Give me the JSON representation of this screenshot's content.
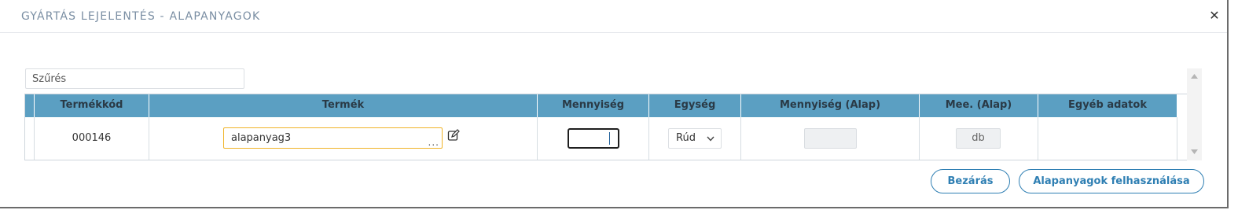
{
  "dialog": {
    "title": "GYÁRTÁS LEJELENTÉS - ALAPANYAGOK",
    "close_icon": "close-icon"
  },
  "filter": {
    "placeholder": "Szűrés"
  },
  "table": {
    "columns": [
      "Termékkód",
      "Termék",
      "Mennyiség",
      "Egység",
      "Mennyiség (Alap)",
      "Mee. (Alap)",
      "Egyéb adatok"
    ],
    "rows": [
      {
        "product_code": "000146",
        "product": "alapanyag3",
        "product_lookup": "...",
        "quantity": "",
        "unit": "Rúd",
        "base_quantity": "",
        "base_unit": "db",
        "other_data": ""
      }
    ]
  },
  "buttons": {
    "close_label": "Bezárás",
    "use_label": "Alapanyagok felhasználása"
  },
  "colors": {
    "header_bg": "#5b9fc2",
    "accent": "#2f7fb3",
    "focus_border": "#f0b429",
    "title": "#7a8ea3"
  }
}
